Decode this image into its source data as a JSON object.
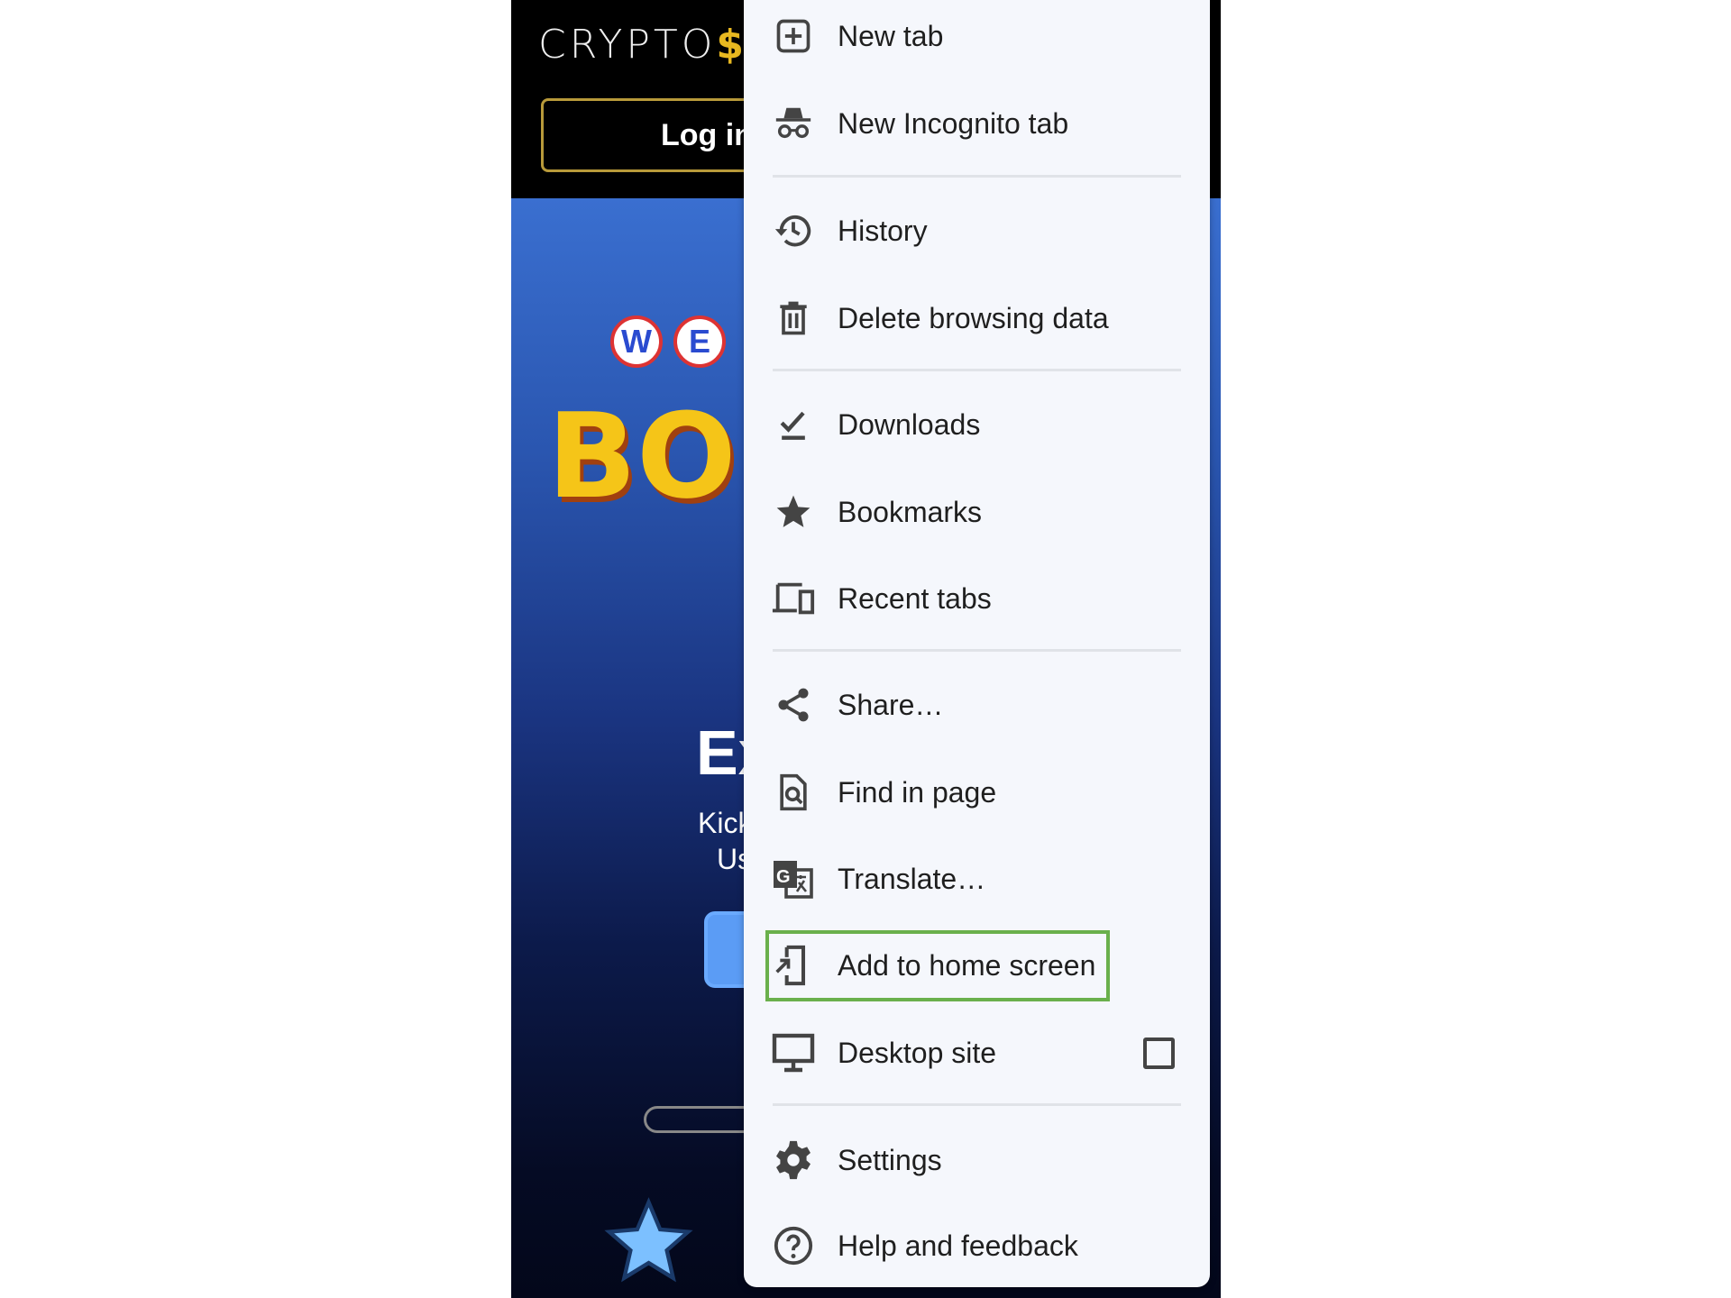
{
  "page": {
    "logo_text": "CRYPTO",
    "logo_symbol": "$",
    "login_label": "Log in",
    "banner_letters": [
      "W",
      "E"
    ],
    "banner_text": "BO",
    "hero_title": "Ex",
    "hero_sub_1": "Kick",
    "hero_sub_2": "Us"
  },
  "menu": {
    "items": [
      {
        "label": "New tab",
        "icon": "new-tab-icon"
      },
      {
        "label": "New Incognito tab",
        "icon": "incognito-icon"
      },
      {
        "label": "History",
        "icon": "history-icon"
      },
      {
        "label": "Delete browsing data",
        "icon": "trash-icon"
      },
      {
        "label": "Downloads",
        "icon": "download-done-icon"
      },
      {
        "label": "Bookmarks",
        "icon": "star-icon"
      },
      {
        "label": "Recent tabs",
        "icon": "devices-icon"
      },
      {
        "label": "Share…",
        "icon": "share-icon"
      },
      {
        "label": "Find in page",
        "icon": "find-in-page-icon"
      },
      {
        "label": "Translate…",
        "icon": "translate-icon"
      },
      {
        "label": "Add to home screen",
        "icon": "add-to-home-icon",
        "highlighted": true
      },
      {
        "label": "Desktop site",
        "icon": "desktop-icon",
        "checkbox": false
      },
      {
        "label": "Settings",
        "icon": "gear-icon"
      },
      {
        "label": "Help and feedback",
        "icon": "help-icon"
      }
    ],
    "highlight_color": "#6ab04c"
  }
}
